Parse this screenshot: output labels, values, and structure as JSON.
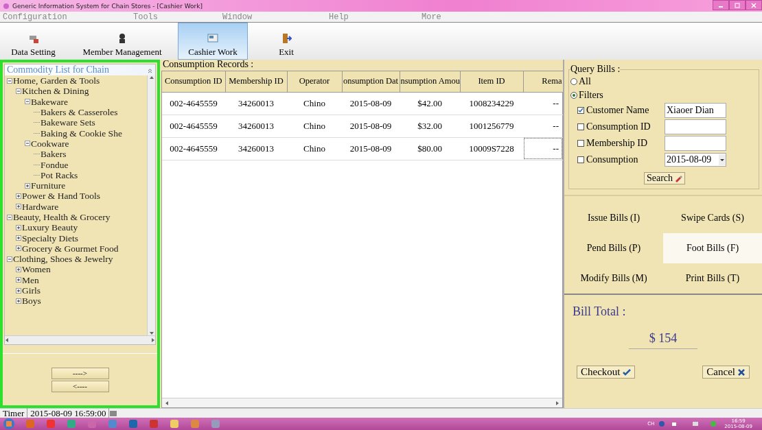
{
  "window": {
    "title": "Generic Information System for Chain Stores - [Cashier Work]"
  },
  "menu": [
    "Configuration",
    "Tools",
    "Window",
    "Help",
    "More"
  ],
  "toolbar": [
    {
      "label": "Data Setting",
      "selected": false
    },
    {
      "label": "Member Management",
      "selected": false
    },
    {
      "label": "Cashier Work",
      "selected": true
    },
    {
      "label": "Exit",
      "selected": false
    }
  ],
  "sidebar": {
    "title": "Commodity List for Chain",
    "tree": [
      {
        "label": "Home, Garden & Tools",
        "expanded": true,
        "children": [
          {
            "label": "Kitchen & Dining",
            "expanded": true,
            "children": [
              {
                "label": "Bakeware",
                "expanded": true,
                "children": [
                  {
                    "label": "Bakers & Casseroles"
                  },
                  {
                    "label": "Bakeware Sets"
                  },
                  {
                    "label": "Baking & Cookie She"
                  }
                ]
              },
              {
                "label": "Cookware",
                "expanded": true,
                "children": [
                  {
                    "label": "Bakers"
                  },
                  {
                    "label": "Fondue"
                  },
                  {
                    "label": "Pot Racks"
                  }
                ]
              },
              {
                "label": "Furniture",
                "expanded": false
              }
            ]
          },
          {
            "label": "Power & Hand Tools",
            "expanded": false
          },
          {
            "label": "Hardware",
            "expanded": false
          }
        ]
      },
      {
        "label": "Beauty, Health & Grocery",
        "expanded": true,
        "children": [
          {
            "label": "Luxury Beauty",
            "expanded": false
          },
          {
            "label": "Specialty Diets",
            "expanded": false
          },
          {
            "label": "Grocery & Gourmet Food",
            "expanded": false
          }
        ]
      },
      {
        "label": "Clothing, Shoes & Jewelry",
        "expanded": true,
        "children": [
          {
            "label": "Women",
            "expanded": false
          },
          {
            "label": "Men",
            "expanded": false
          },
          {
            "label": "Girls",
            "expanded": false
          },
          {
            "label": "Boys",
            "expanded": false
          }
        ]
      }
    ],
    "buttons": [
      "---->",
      "<----"
    ]
  },
  "table": {
    "title": "Consumption Records :",
    "columns": [
      "Consumption ID",
      "Membership ID",
      "Operator",
      "onsumption Dat",
      "nsumption Amou",
      "Item ID",
      "Rema"
    ],
    "rows": [
      {
        "cells": [
          "002-4645559",
          "34260013",
          "Chino",
          "2015-08-09",
          "$42.00",
          "1008234229",
          "--"
        ],
        "focused": false
      },
      {
        "cells": [
          "002-4645559",
          "34260013",
          "Chino",
          "2015-08-09",
          "$32.00",
          "1001256779",
          "--"
        ],
        "focused": false
      },
      {
        "cells": [
          "002-4645559",
          "34260013",
          "Chino",
          "2015-08-09",
          "$80.00",
          "10009S7228",
          "--"
        ],
        "focused": true
      }
    ]
  },
  "query": {
    "title": "Query Bills :",
    "modes": [
      {
        "label": "All",
        "selected": false
      },
      {
        "label": "Filters",
        "selected": true
      }
    ],
    "filters": [
      {
        "label": "Customer Name",
        "checked": true,
        "kind": "text",
        "value": "Xiaoer Dian"
      },
      {
        "label": "Consumption ID",
        "checked": false,
        "kind": "text"
      },
      {
        "label": "Membership ID",
        "checked": false,
        "kind": "text"
      },
      {
        "label": "Consumption",
        "checked": false,
        "kind": "date",
        "value": "2015-08-09"
      }
    ],
    "search": "Search"
  },
  "actions": [
    {
      "label": "Issue Bills (I)",
      "selected": false
    },
    {
      "label": "Swipe Cards (S)",
      "selected": false
    },
    {
      "label": "Pend Bills (P)",
      "selected": false
    },
    {
      "label": "Foot Bills (F)",
      "selected": true
    },
    {
      "label": "Modify Bills (M)",
      "selected": false
    },
    {
      "label": "Print Bills (T)",
      "selected": false
    }
  ],
  "bill": {
    "label": "Bill Total :",
    "total": "$ 154",
    "checkout": "Checkout",
    "cancel": "Cancel"
  },
  "status_bar": {
    "label": "Timer",
    "time": "2015-08-09 16:59:00"
  },
  "taskbar": {
    "ime": "CH",
    "clock": "16:59",
    "date": "2015-08-09"
  }
}
